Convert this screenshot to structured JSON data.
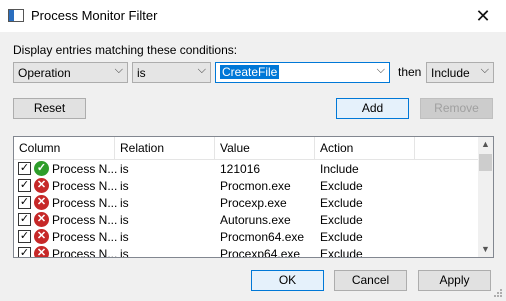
{
  "window": {
    "title": "Process Monitor Filter",
    "close_glyph": "✕"
  },
  "conditions": {
    "label": "Display entries matching these conditions:",
    "column": "Operation",
    "relation": "is",
    "value": "CreateFile",
    "then_label": "then",
    "action": "Include"
  },
  "buttons": {
    "reset": "Reset",
    "add": "Add",
    "remove": "Remove",
    "ok": "OK",
    "cancel": "Cancel",
    "apply": "Apply"
  },
  "list": {
    "headers": [
      "Column",
      "Relation",
      "Value",
      "Action"
    ],
    "rows": [
      {
        "column": "Process N...",
        "relation": "is",
        "value": "121016",
        "action": "Include",
        "checked": true,
        "status": "include-icon"
      },
      {
        "column": "Process N...",
        "relation": "is",
        "value": "Procmon.exe",
        "action": "Exclude",
        "checked": true,
        "status": "exclude-icon"
      },
      {
        "column": "Process N...",
        "relation": "is",
        "value": "Procexp.exe",
        "action": "Exclude",
        "checked": true,
        "status": "exclude-icon"
      },
      {
        "column": "Process N...",
        "relation": "is",
        "value": "Autoruns.exe",
        "action": "Exclude",
        "checked": true,
        "status": "exclude-icon"
      },
      {
        "column": "Process N...",
        "relation": "is",
        "value": "Procmon64.exe",
        "action": "Exclude",
        "checked": true,
        "status": "exclude-icon"
      },
      {
        "column": "Process N...",
        "relation": "is",
        "value": "Procexp64.exe",
        "action": "Exclude",
        "checked": true,
        "status": "exclude-icon"
      }
    ]
  },
  "colors": {
    "accent": "#0078d7",
    "include": "#2e9d2a",
    "exclude": "#c62828"
  }
}
